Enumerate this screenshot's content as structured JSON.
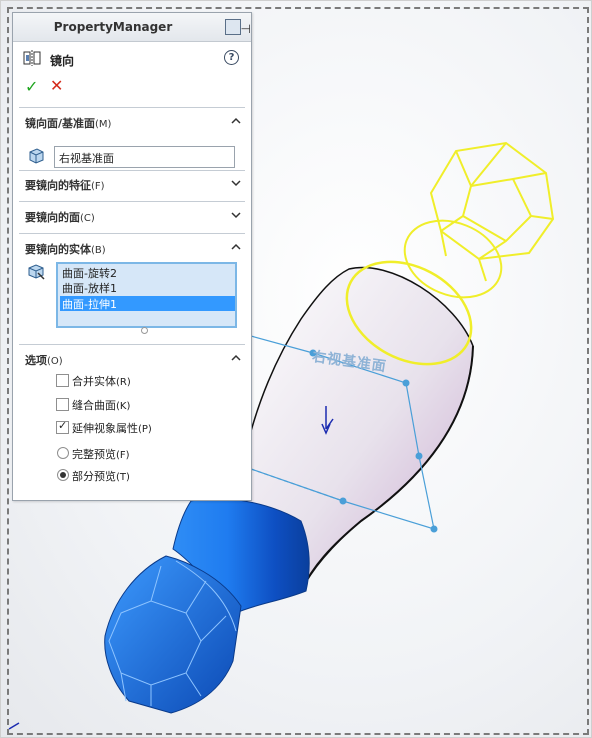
{
  "property_manager": {
    "title": "PropertyManager",
    "feature_name": "镜向",
    "help_label": "?",
    "ok_icon": "checkmark-icon",
    "cancel_icon": "cross-icon"
  },
  "sections": {
    "mirror_plane": {
      "title": "镜向面/基准面",
      "key": "(M)",
      "value": "右视基准面",
      "expanded": true
    },
    "features": {
      "title": "要镜向的特征",
      "key": "(F)",
      "expanded": false
    },
    "faces": {
      "title": "要镜向的面",
      "key": "(C)",
      "expanded": false
    },
    "bodies": {
      "title": "要镜向的实体",
      "key": "(B)",
      "expanded": true,
      "items": [
        "曲面-旋转2",
        "曲面-放样1",
        "曲面-拉伸1"
      ],
      "selected_index": 2
    },
    "options": {
      "title": "选项",
      "key": "(O)",
      "expanded": true,
      "checkboxes": [
        {
          "label": "合并实体",
          "key": "(R)",
          "checked": false
        },
        {
          "label": "缝合曲面",
          "key": "(K)",
          "checked": false
        },
        {
          "label": "延伸视象属性",
          "key": "(P)",
          "checked": true
        }
      ],
      "radios": [
        {
          "label": "完整预览",
          "key": "(F)",
          "selected": false
        },
        {
          "label": "部分预览",
          "key": "(T)",
          "selected": true
        }
      ]
    }
  },
  "viewport": {
    "plane_label": "右视基准面",
    "colors": {
      "body_blue": "#1a6fe0",
      "preview_yellow": "#f0ee2a",
      "plane_line": "#4a9fd8"
    }
  }
}
